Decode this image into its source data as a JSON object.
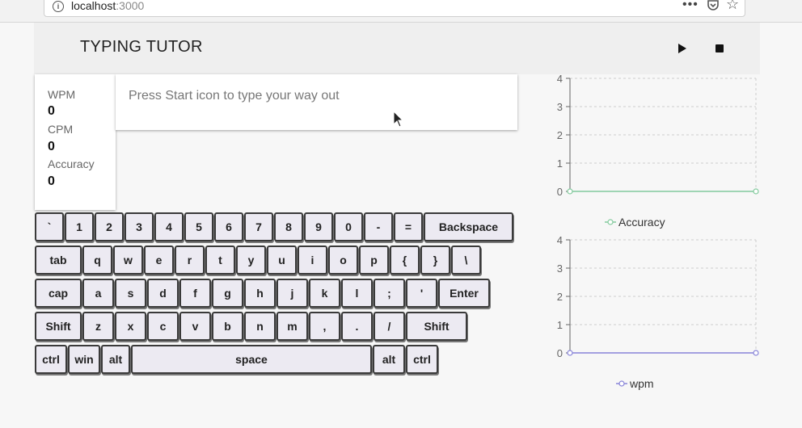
{
  "browser": {
    "url_host": "localhost",
    "url_port": ":3000",
    "info_icon": "info-icon",
    "menu_icon": "ellipsis-icon",
    "pocket_icon": "pocket-icon",
    "bookmark_icon": "star-icon"
  },
  "header": {
    "title": "TYPING TUTOR",
    "play_icon": "play-icon",
    "stop_icon": "stop-icon"
  },
  "stats": {
    "wpm_label": "WPM",
    "wpm_value": "0",
    "cpm_label": "CPM",
    "cpm_value": "0",
    "accuracy_label": "Accuracy",
    "accuracy_value": "0"
  },
  "prompt": {
    "text": "Press Start icon to type your way out"
  },
  "keyboard": {
    "rows": [
      [
        "`",
        "1",
        "2",
        "3",
        "4",
        "5",
        "6",
        "7",
        "8",
        "9",
        "0",
        "-",
        "=",
        "Backspace"
      ],
      [
        "tab",
        "q",
        "w",
        "e",
        "r",
        "t",
        "y",
        "u",
        "i",
        "o",
        "p",
        "{",
        "}",
        "\\"
      ],
      [
        "cap",
        "a",
        "s",
        "d",
        "f",
        "g",
        "h",
        "j",
        "k",
        "l",
        ";",
        "'",
        "Enter"
      ],
      [
        "Shift",
        "z",
        "x",
        "c",
        "v",
        "b",
        "n",
        "m",
        ",",
        ".",
        "/",
        "Shift"
      ],
      [
        "ctrl",
        "win",
        "alt",
        "space",
        "alt",
        "ctrl"
      ]
    ]
  },
  "colors": {
    "accuracy_series": "#82ca9d",
    "wpm_series": "#8884d8",
    "grid": "#cccccc",
    "key_face": "#eceaf2"
  },
  "chart_data": [
    {
      "type": "line",
      "x": [
        0,
        1
      ],
      "series": [
        {
          "name": "Accuracy",
          "values": [
            0,
            0
          ]
        }
      ],
      "yticks": [
        "0",
        "1",
        "2",
        "3",
        "4"
      ],
      "ylim": [
        0,
        4
      ],
      "grid": true,
      "legend": "bottom-center"
    },
    {
      "type": "line",
      "x": [
        0,
        1
      ],
      "series": [
        {
          "name": "wpm",
          "values": [
            0,
            0
          ]
        }
      ],
      "yticks": [
        "0",
        "1",
        "2",
        "3",
        "4"
      ],
      "ylim": [
        0,
        4
      ],
      "grid": true,
      "legend": "bottom-center"
    }
  ]
}
